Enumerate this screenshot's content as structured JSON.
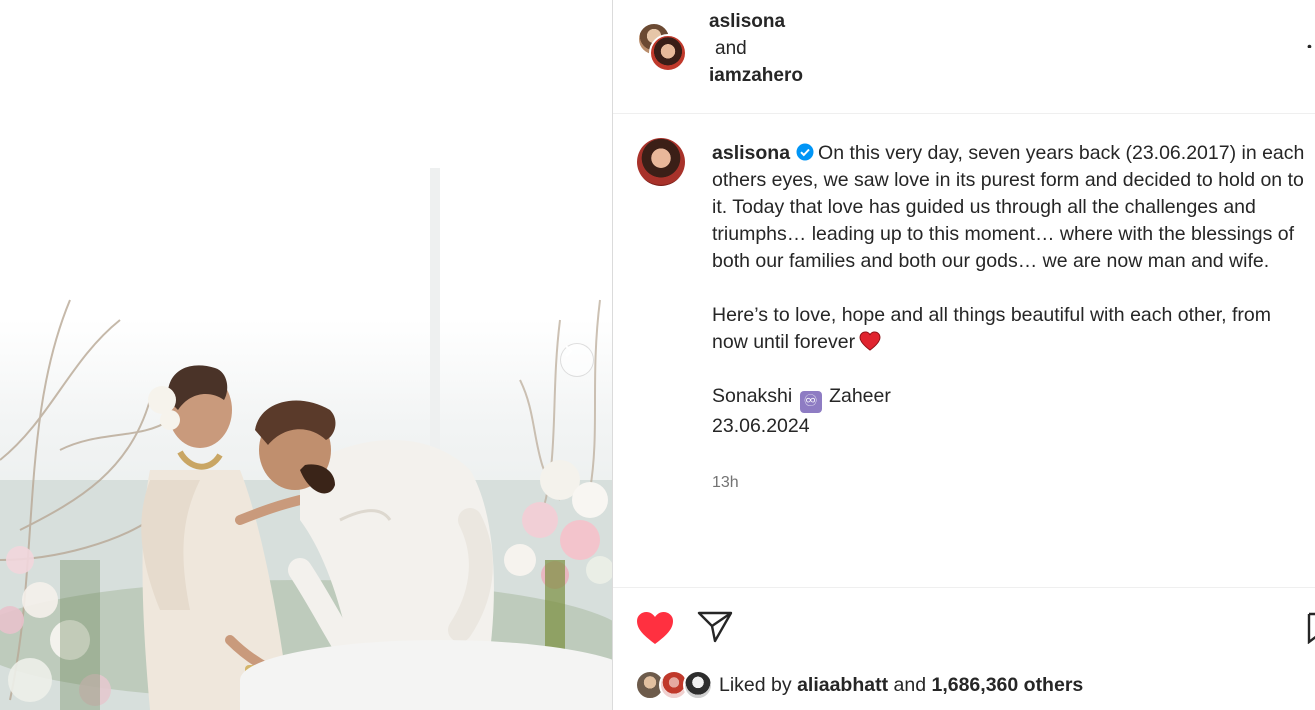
{
  "header": {
    "user1": "aslisona",
    "connector": "and",
    "user2": "iamzahero"
  },
  "caption": {
    "author": "aslisona",
    "paragraph1": "On this very day, seven years back (23.06.2017) in each others eyes, we saw love in its purest form and decided to hold on to it. Today that love has guided us through all the challenges and triumphs… leading up to this moment… where with the blessings of both our families and both our gods… we are now man and wife.",
    "paragraph2": "Here’s to love, hope and all things beautiful with each other, from now until forever",
    "names_left": "Sonakshi",
    "names_emoji": "♾",
    "names_right": "Zaheer",
    "date": "23.06.2024",
    "time_ago": "13h"
  },
  "likes": {
    "prefix": "Liked by",
    "user": "aliaabhatt",
    "connector": "and",
    "count_text": "1,686,360 others"
  },
  "colors": {
    "like_red": "#ff3040",
    "verified_blue": "#0095f6",
    "text": "#262626",
    "muted": "#737373"
  },
  "icons": {
    "like": "heart-filled-icon",
    "share": "paper-plane-icon",
    "save": "bookmark-icon",
    "more": "more-options-icon",
    "next": "chevron-right-icon"
  }
}
